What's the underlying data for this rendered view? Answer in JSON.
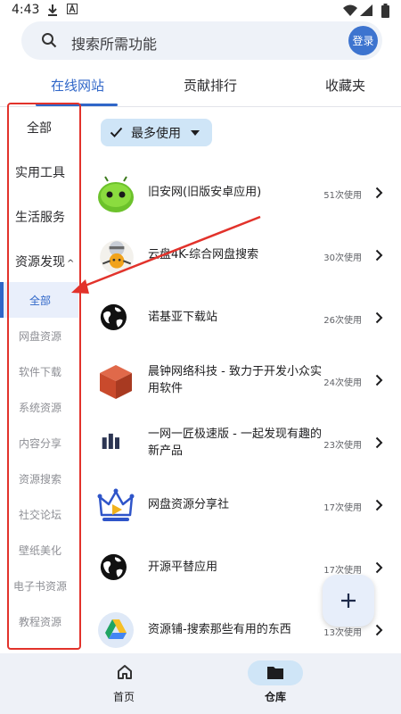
{
  "status_bar": {
    "time": "4:43"
  },
  "search": {
    "placeholder": "搜索所需功能",
    "login_label": "登录"
  },
  "tabs": [
    {
      "label": "在线网站",
      "active": true
    },
    {
      "label": "贡献排行",
      "active": false
    },
    {
      "label": "收藏夹",
      "active": false
    }
  ],
  "sidebar": {
    "main": [
      "全部",
      "实用工具",
      "生活服务",
      "资源发现"
    ],
    "expanded_caret": "^",
    "sub": [
      "全部",
      "网盘资源",
      "软件下载",
      "系统资源",
      "内容分享",
      "资源搜索",
      "社交论坛",
      "壁纸美化",
      "电子书资源",
      "教程资源"
    ]
  },
  "filter": {
    "label": "最多使用"
  },
  "sites": [
    {
      "title": "旧安网(旧版安卓应用)",
      "count": "51次使用",
      "icon": "android-icon"
    },
    {
      "title": "云盘4K-综合网盘搜索",
      "count": "30次使用",
      "icon": "cat-mascot-icon"
    },
    {
      "title": "诺基亚下载站",
      "count": "26次使用",
      "icon": "globe-icon"
    },
    {
      "title": "晨钟网络科技 - 致力于开发小众实用软件",
      "count": "24次使用",
      "icon": "cube-icon"
    },
    {
      "title": "一网一匠极速版 - 一起发现有趣的新产品",
      "count": "23次使用",
      "icon": "bars-icon"
    },
    {
      "title": "网盘资源分享社",
      "count": "17次使用",
      "icon": "crown-play-icon"
    },
    {
      "title": "开源平替应用",
      "count": "17次使用",
      "icon": "globe-icon"
    },
    {
      "title": "资源铺-搜索那些有用的东西",
      "count": "13次使用",
      "icon": "drive-icon"
    }
  ],
  "bottom_nav": {
    "home_label": "首页",
    "repo_label": "仓库"
  },
  "colors": {
    "accent": "#2f66c8",
    "annotation": "#e2322b",
    "chip": "#cfe5f7"
  }
}
